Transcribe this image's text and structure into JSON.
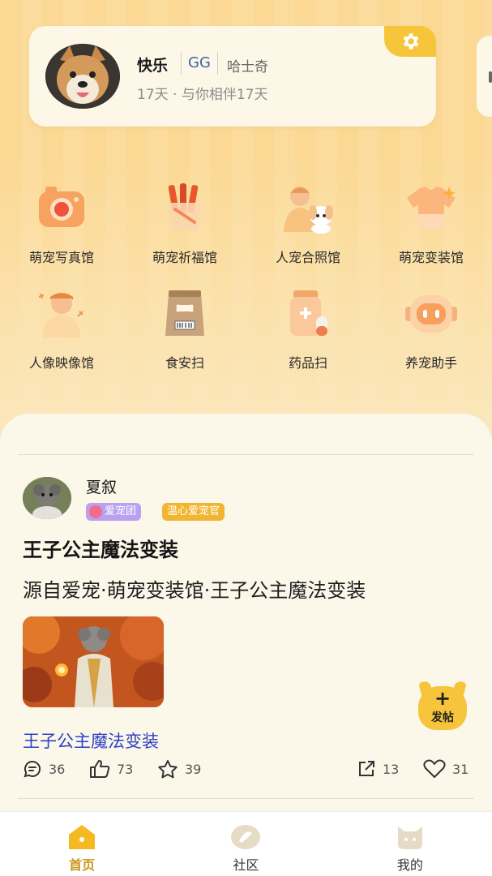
{
  "profile": {
    "name": "快乐",
    "tag": "GG",
    "breed": "哈士奇",
    "days_text": "17天 · 与你相伴17天"
  },
  "features": [
    {
      "label": "萌宠写真馆",
      "icon": "camera-icon"
    },
    {
      "label": "萌宠祈福馆",
      "icon": "treat-cup-icon"
    },
    {
      "label": "人宠合照馆",
      "icon": "person-with-dog-icon"
    },
    {
      "label": "萌宠变装馆",
      "icon": "tshirt-icon"
    },
    {
      "label": "人像映像馆",
      "icon": "person-portrait-icon"
    },
    {
      "label": "食安扫",
      "icon": "food-bag-icon"
    },
    {
      "label": "药品扫",
      "icon": "medicine-bottle-icon"
    },
    {
      "label": "养宠助手",
      "icon": "robot-icon"
    }
  ],
  "post": {
    "username": "夏叙",
    "badge_1": "爱宠团",
    "badge_2": "温心爱宠官",
    "title": "王子公主魔法变装",
    "source": "源自爱宠·萌宠变装馆·王子公主魔法变装",
    "link_text": "王子公主魔法变装",
    "comments": "36",
    "likes": "73",
    "favorites": "39",
    "shares": "13",
    "hearts": "31"
  },
  "fab": {
    "label": "发帖",
    "plus": "+"
  },
  "nav": [
    {
      "label": "首页",
      "active": true
    },
    {
      "label": "社区",
      "active": false
    },
    {
      "label": "我的",
      "active": false
    }
  ],
  "colors": {
    "accent": "#f7c53a",
    "link": "#2b3fc7",
    "background": "#fbdb9a"
  }
}
